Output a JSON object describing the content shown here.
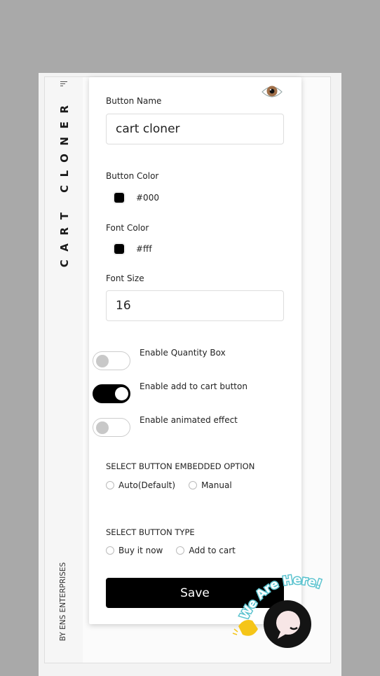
{
  "sidebar": {
    "brand": "CART CLONER",
    "byline": "BY ENS ENTERPRISES"
  },
  "form": {
    "button_name": {
      "label": "Button Name",
      "value": "cart cloner"
    },
    "button_color": {
      "label": "Button Color",
      "value": "#000",
      "swatch": "#000000"
    },
    "font_color": {
      "label": "Font Color",
      "value": "#fff",
      "swatch": "#000000"
    },
    "font_size": {
      "label": "Font Size",
      "value": "16"
    },
    "toggles": [
      {
        "label": "Enable Quantity Box",
        "on": false
      },
      {
        "label": "Enable add to cart button",
        "on": true
      },
      {
        "label": "Enable animated effect",
        "on": false
      }
    ],
    "embedded_option": {
      "title": "SELECT BUTTON EMBEDDED OPTION",
      "options": [
        "Auto(Default)",
        "Manual"
      ]
    },
    "button_type": {
      "title": "SELECT BUTTON TYPE",
      "options": [
        "Buy it now",
        "Add to cart"
      ]
    },
    "save_label": "Save"
  },
  "chat_widget": {
    "text": "We Are Here!",
    "icon": "chat-bubble-icon"
  },
  "colors": {
    "accent": "#000000",
    "background": "#a9a9a9",
    "chat_text": "#5bc3cf",
    "wave_hand": "#f5c518"
  }
}
